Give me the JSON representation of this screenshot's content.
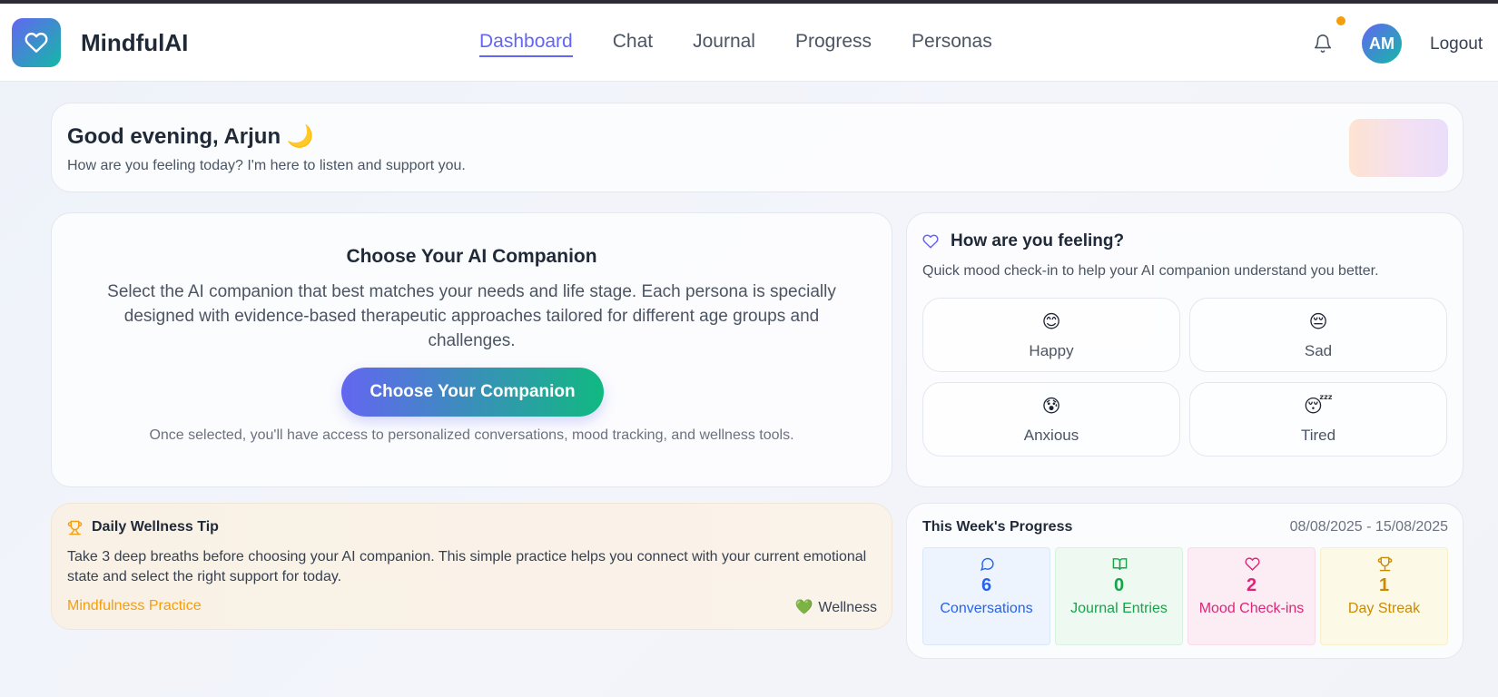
{
  "app": {
    "name": "MindfulAI"
  },
  "nav": {
    "items": [
      {
        "label": "Dashboard",
        "active": true
      },
      {
        "label": "Chat"
      },
      {
        "label": "Journal"
      },
      {
        "label": "Progress"
      },
      {
        "label": "Personas"
      }
    ],
    "avatar_initials": "AM",
    "logout_label": "Logout"
  },
  "greeting": {
    "title": "Good evening, Arjun 🌙",
    "subtitle": "How are you feeling today? I'm here to listen and support you."
  },
  "companion": {
    "title": "Choose Your AI Companion",
    "description": "Select the AI companion that best matches your needs and life stage. Each persona is specially designed with evidence-based therapeutic approaches tailored for different age groups and challenges.",
    "button_label": "Choose Your Companion",
    "note": "Once selected, you'll have access to personalized conversations, mood tracking, and wellness tools."
  },
  "mood": {
    "title": "How are you feeling?",
    "subtitle": "Quick mood check-in to help your AI companion understand you better.",
    "options": [
      {
        "emoji": "😊",
        "label": "Happy"
      },
      {
        "emoji": "😔",
        "label": "Sad"
      },
      {
        "emoji": "😰",
        "label": "Anxious"
      },
      {
        "emoji": "😴",
        "label": "Tired"
      }
    ]
  },
  "tip": {
    "title": "Daily Wellness Tip",
    "text": "Take 3 deep breaths before choosing your AI companion. This simple practice helps you connect with your current emotional state and select the right support for today.",
    "category": "Mindfulness Practice",
    "tag": "Wellness"
  },
  "progress": {
    "title": "This Week's Progress",
    "date_range": "08/08/2025 - 15/08/2025",
    "stats": [
      {
        "icon": "chat-bubble-icon",
        "value": "6",
        "label": "Conversations",
        "color": "#2563eb",
        "bg": "#eef4fe",
        "border": "#dbe7fb"
      },
      {
        "icon": "book-icon",
        "value": "0",
        "label": "Journal Entries",
        "color": "#16a34a",
        "bg": "#eefaf1",
        "border": "#d8f2df"
      },
      {
        "icon": "heart-icon",
        "value": "2",
        "label": "Mood Check-ins",
        "color": "#db2777",
        "bg": "#fcedf4",
        "border": "#f8dcea"
      },
      {
        "icon": "trophy-icon",
        "value": "1",
        "label": "Day Streak",
        "color": "#ca8a04",
        "bg": "#fdf9e7",
        "border": "#f8efcb"
      }
    ]
  },
  "colors": {
    "accent": "#6366f1",
    "teal": "#14b8a6",
    "warning": "#f59e0b"
  }
}
